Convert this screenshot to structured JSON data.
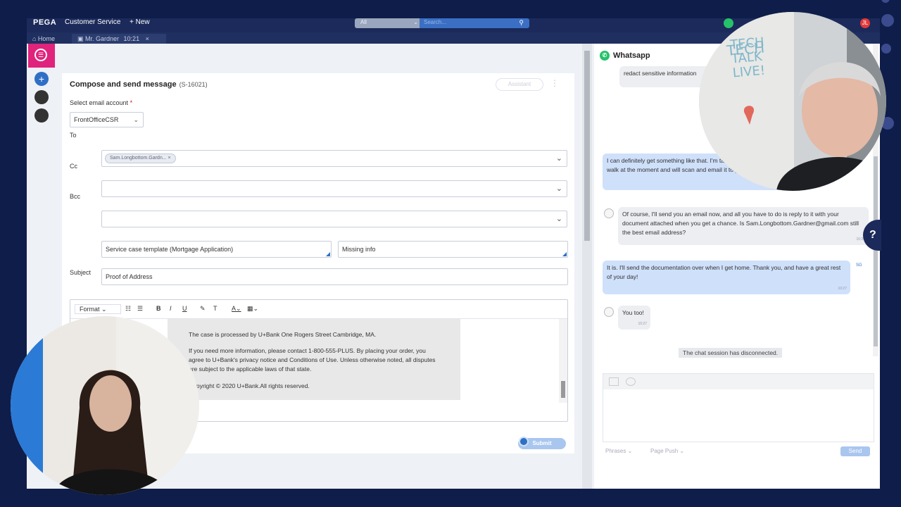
{
  "topbar": {
    "brand": "PEGA",
    "app": "Customer Service",
    "new_label": "+ New",
    "scope": "All",
    "search_placeholder": "Search..."
  },
  "tabs": {
    "home": "⌂ Home",
    "active": "Mr. Gardner",
    "active_time": "10:21"
  },
  "compose": {
    "title": "Compose and send message",
    "case_id": "(S-16021)",
    "assistant": "Assistant",
    "account_label": "Select email account",
    "required": "*",
    "account_value": "FrontOfficeCSR",
    "to_label": "To",
    "to_chip": "Sam.Longbottom.Gardn...",
    "cc_label": "Cc",
    "bcc_label": "Bcc",
    "template": "Service case template (Mortgage Application)",
    "template2": "Missing info",
    "subject_label": "Subject",
    "subject_value": "Proof of Address",
    "toolbar": {
      "format": "Format",
      "bold": "B",
      "italic": "I",
      "underline": "U",
      "clear": "T"
    },
    "body": {
      "p1": "The case is processed by U+Bank One Rogers Street Cambridge, MA.",
      "p2": "If you need more information, please contact 1-800-555-PLUS. By placing your order, you agree to U+Bank's privacy notice and Conditions of Use. Unless otherwise noted, all disputes are subject to the applicable laws of that state.",
      "p3": "Copyright © 2020 U+Bank.All rights reserved."
    },
    "submit": "Submit"
  },
  "chat": {
    "channel": "Whatsapp",
    "m0": "redact sensitive information",
    "m1": "I can definitely get something like that. I'm taking the dog for a walk at the moment and will scan and email it to you later?",
    "m2": "Of course, I'll send you an email now, and all you have to do is reply to it with your document attached when you get a chance. Is Sam.Longbottom.Gardner@gmail.com still the best email address?",
    "m2_time": "10:26",
    "m3": "It is. I'll send the documentation over when I get home. Thank you, and have a great rest of your day!",
    "m3_time": "10:27",
    "m3_initials": "SG",
    "m4": "You too!",
    "m4_time": "10:27",
    "disconnected": "The chat session has disconnected.",
    "phrases": "Phrases",
    "page_push": "Page Push",
    "send": "Send"
  },
  "overlay": {
    "whiteboard": "TECH TALK LIVE!",
    "help": "?"
  },
  "colors": {
    "frame_bg": "#0f1d4a",
    "brand_nav": "#1b2a5a",
    "accent": "#2f6fc6",
    "whatsapp": "#25c26a",
    "rail_accent": "#e0237c"
  }
}
